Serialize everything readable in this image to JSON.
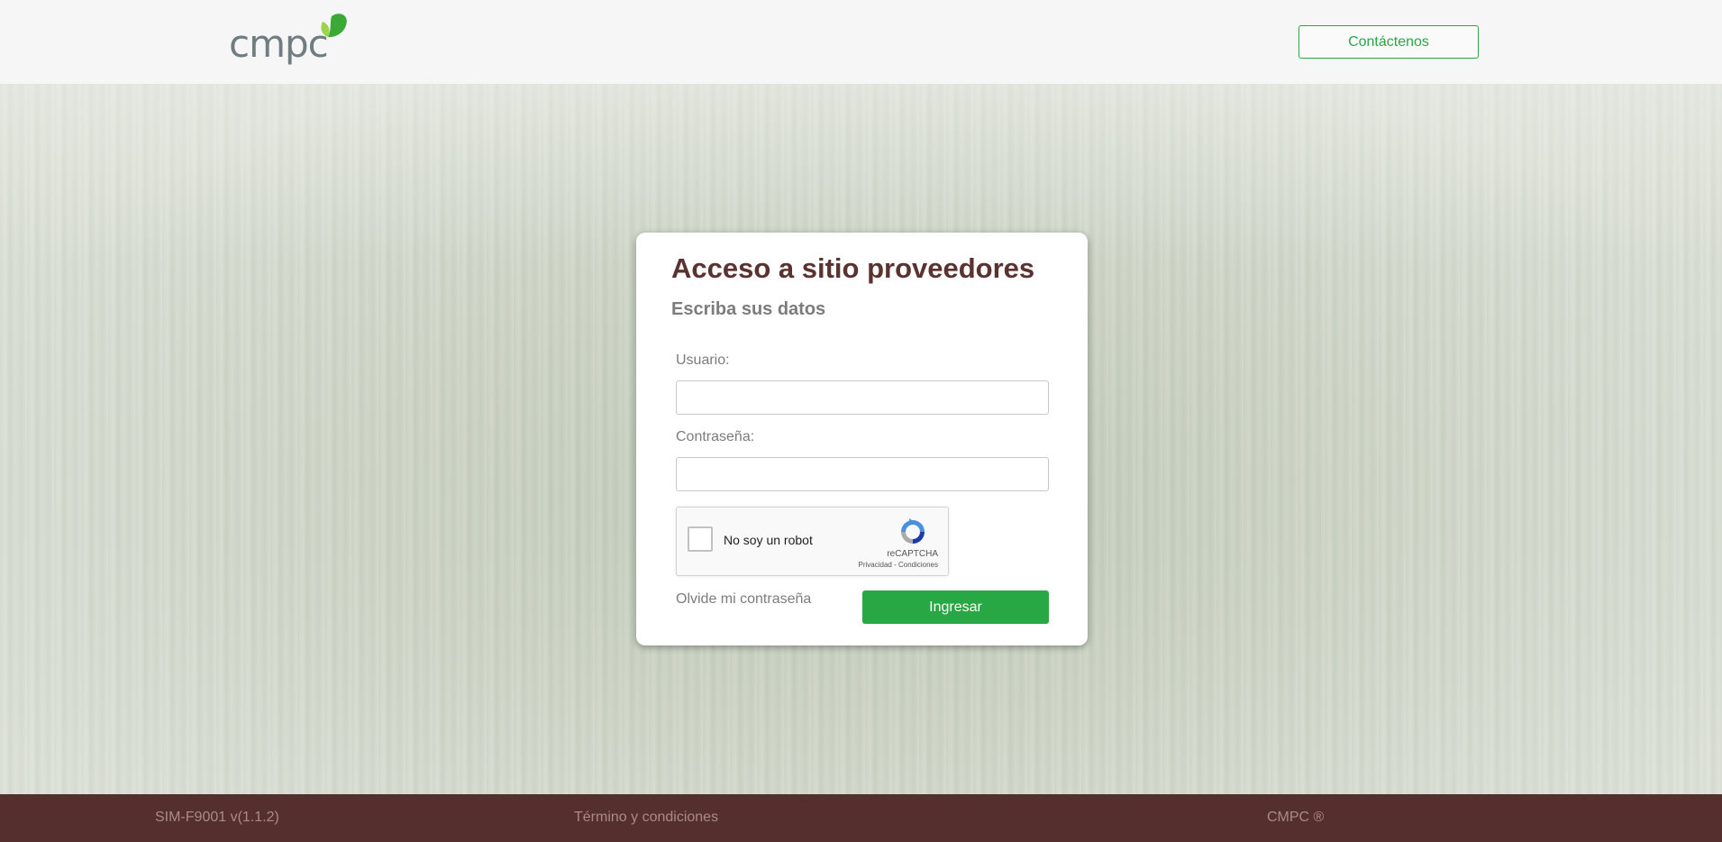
{
  "header": {
    "logo_text": "cmpc",
    "contact_label": "Contáctenos"
  },
  "colors": {
    "brand_green": "#28a745",
    "title_brown": "#5a3330",
    "footer_bg": "#552f2e"
  },
  "login": {
    "title": "Acceso a sitio proveedores",
    "subtitle": "Escriba sus datos",
    "user_label": "Usuario:",
    "user_value": "",
    "password_label": "Contraseña:",
    "password_value": "",
    "forgot_label": "Olvide mi contraseña",
    "submit_label": "Ingresar"
  },
  "captcha": {
    "label": "No soy un robot",
    "brand": "reCAPTCHA",
    "links": "Privacidad - Condiciones",
    "checked": false
  },
  "footer": {
    "version": "SIM-F9001 v(1.1.2)",
    "terms": "Término y condiciones",
    "copyright": "CMPC ®"
  }
}
